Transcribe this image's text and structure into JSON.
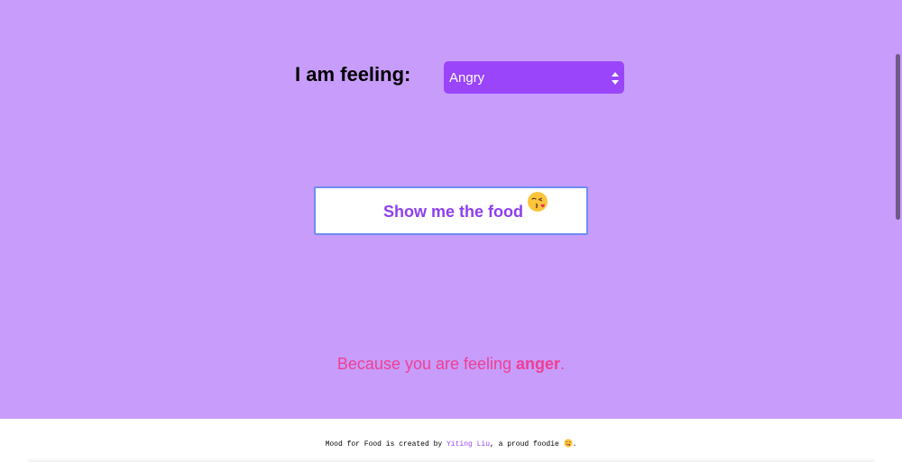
{
  "form": {
    "label": "I am feeling:",
    "selected_mood": "Angry"
  },
  "action": {
    "button_label": "Show me the food",
    "emoji": "face-blowing-kiss-emoji"
  },
  "result": {
    "prefix": "Because you are feeling ",
    "emotion": "anger",
    "suffix": "."
  },
  "footer": {
    "text_before": "Mood for Food is created by ",
    "author_link": "Yiting Liu",
    "text_after": ", a proud foodie ",
    "end_mark": ".",
    "emoji": "face-savoring-food-emoji"
  },
  "colors": {
    "background": "#c89cfa",
    "select_bg": "#9a45fa",
    "button_text": "#8d3ff0",
    "button_border": "#6f8cf5",
    "result_text": "#ee3f94",
    "link": "#9a45fa"
  }
}
